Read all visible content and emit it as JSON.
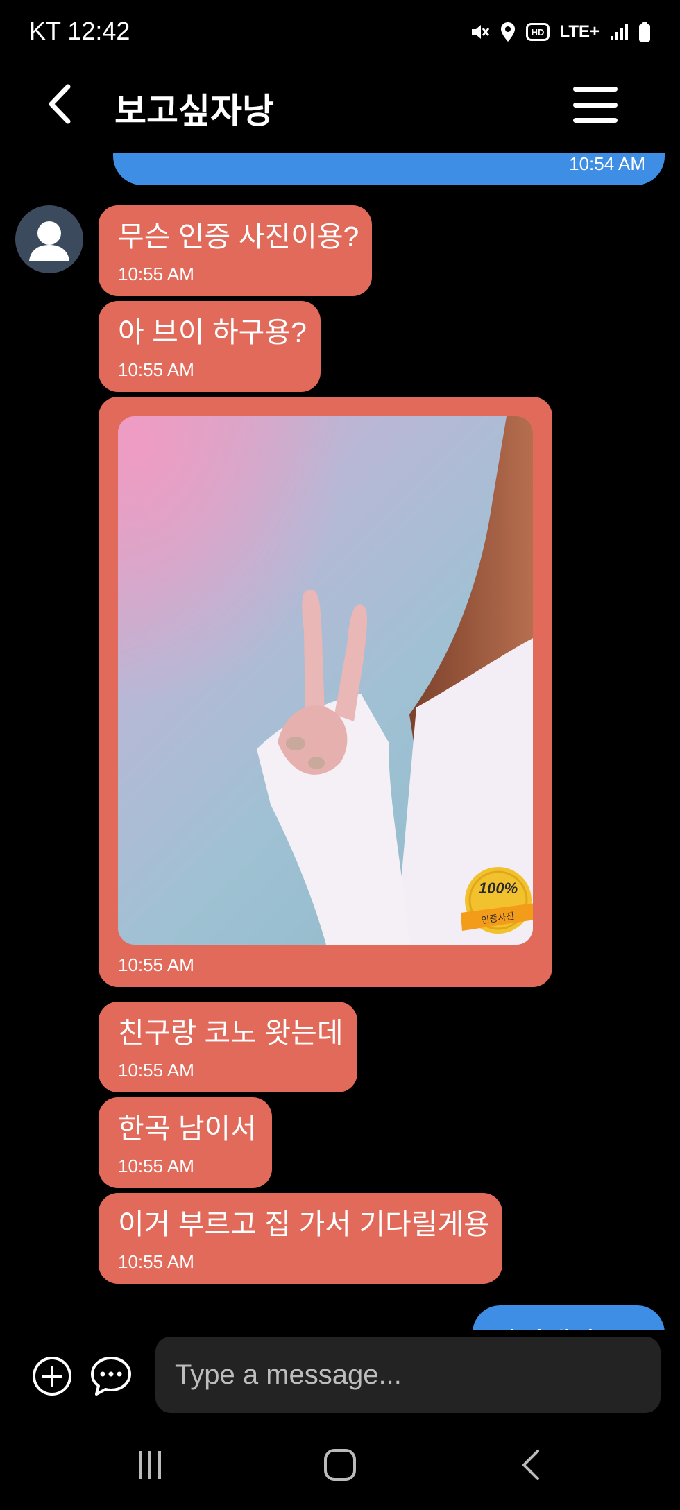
{
  "status_bar": {
    "carrier_time": "KT 12:42",
    "network": "LTE+",
    "hd_label": "HD",
    "icons": [
      "mute-icon",
      "location-icon",
      "hd-icon",
      "lte-icon",
      "signal-icon",
      "battery-icon"
    ]
  },
  "header": {
    "title": "보고싶자낭",
    "back_icon": "chevron-left-icon",
    "menu_icon": "hamburger-menu-icon"
  },
  "messages": {
    "sent_top": {
      "time": "10:54 AM"
    },
    "received": [
      {
        "text": "무슨 인증 사진이용?",
        "time": "10:55 AM"
      },
      {
        "text": "아 브이 하구용?",
        "time": "10:55 AM"
      },
      {
        "type": "photo",
        "badge_percent": "100%",
        "badge_label": "인증사진",
        "time": "10:55 AM"
      },
      {
        "text": "친구랑 코노 왓는데",
        "time": "10:55 AM"
      },
      {
        "text": "한곡 남이서",
        "time": "10:55 AM"
      },
      {
        "text": "이거 부르고 집 가서 기다릴게용",
        "time": "10:55 AM"
      }
    ],
    "sent_bottom": {
      "text": "마있겠다는 ="
    }
  },
  "input": {
    "placeholder": "Type a message..."
  },
  "colors": {
    "received_bubble": "#e26a5b",
    "sent_bubble": "#3d8ee4",
    "background": "#000000",
    "input_background": "#232323"
  }
}
